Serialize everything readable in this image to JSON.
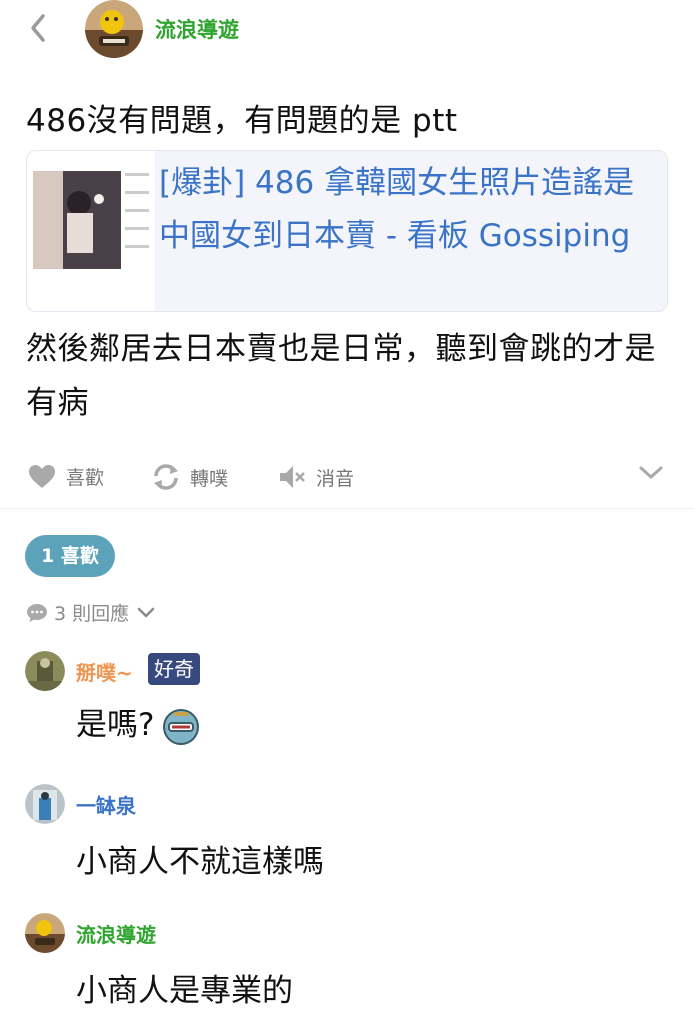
{
  "header": {
    "author_name": "流浪導遊",
    "author_color": "#2fa52f"
  },
  "post": {
    "line1": "486沒有問題，有問題的是 ptt",
    "link_card": {
      "title": "[爆卦] 486 拿韓國女生照片造謠是中國女到日本賣 - 看板 Gossiping",
      "title_color": "#3a73c7"
    },
    "line2": "然後鄰居去日本賣也是日常，聽到會跳的才是有病"
  },
  "actions": {
    "like": "喜歡",
    "share": "轉噗",
    "mute": "消音"
  },
  "likes_badge": "1 喜歡",
  "replies": {
    "count_label": "3 則回應"
  },
  "comments": [
    {
      "name": "掰噗~",
      "name_color": "#f0944f",
      "tag": "好奇",
      "text": "是嗎?"
    },
    {
      "name": "一缽泉",
      "name_color": "#3a73c7",
      "text": "小商人不就這樣嗎"
    },
    {
      "name": "流浪導遊",
      "name_color": "#2fa52f",
      "text": "小商人是專業的"
    }
  ]
}
